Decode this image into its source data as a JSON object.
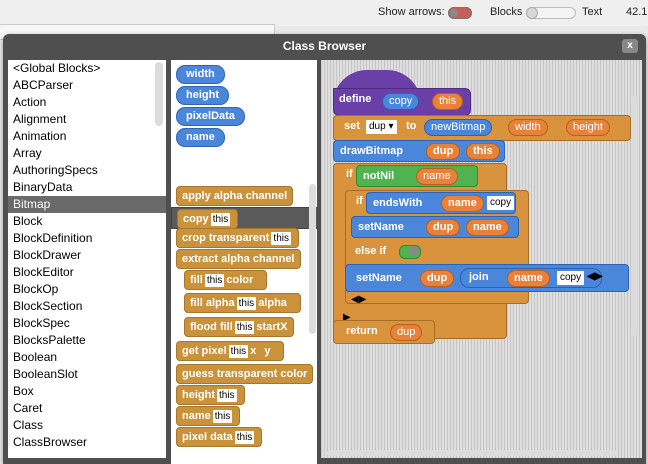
{
  "topbar": {
    "show_arrows_label": "Show arrows:",
    "blocks_label": "Blocks",
    "text_label": "Text",
    "version": "42.1"
  },
  "dialog": {
    "title": "Class Browser",
    "close_label": "x"
  },
  "class_list": [
    "<Global Blocks>",
    "ABCParser",
    "Action",
    "Alignment",
    "Animation",
    "Array",
    "AuthoringSpecs",
    "BinaryData",
    "Bitmap",
    "Block",
    "BlockDefinition",
    "BlockDrawer",
    "BlockEditor",
    "BlockOp",
    "BlockSection",
    "BlockSpec",
    "BlocksPalette",
    "Boolean",
    "BooleanSlot",
    "Box",
    "Caret",
    "Class",
    "ClassBrowser"
  ],
  "selected_class": "Bitmap",
  "fields": [
    "width",
    "height",
    "pixelData",
    "name"
  ],
  "methods": {
    "apply_alpha": "apply alpha channel",
    "copy": "copy",
    "copy_slot": "this",
    "crop": "crop transparent",
    "crop_slot": "this",
    "extract": "extract alpha channel",
    "fill": "fill",
    "fill_slot1": "this",
    "fill_color": "color",
    "fill_alpha": "fill alpha",
    "fill_alpha_slot": "this",
    "fill_alpha_arg": "alpha",
    "flood": "flood fill",
    "flood_slot": "this",
    "flood_arg": "startX",
    "get_pixel": "get pixel",
    "get_pixel_slot": "this",
    "get_pixel_x": "x",
    "get_pixel_y": "y",
    "guess": "guess transparent color",
    "height": "height",
    "height_slot": "this",
    "name": "name",
    "name_slot": "this",
    "pixel_data": "pixel data",
    "pixel_data_slot": "this"
  },
  "script": {
    "define": "define",
    "define_name": "copy",
    "define_param": "this",
    "set": "set",
    "set_var": "dup",
    "to": "to",
    "newBitmap": "newBitmap",
    "width": "width",
    "height": "height",
    "drawBitmap": "drawBitmap",
    "dup": "dup",
    "this": "this",
    "if": "if",
    "notNil": "notNil",
    "name": "name",
    "endsWith": "endsWith",
    "copy_text": "copy",
    "setName": "setName",
    "else_if": "else if",
    "join": "join",
    "return": "return"
  }
}
